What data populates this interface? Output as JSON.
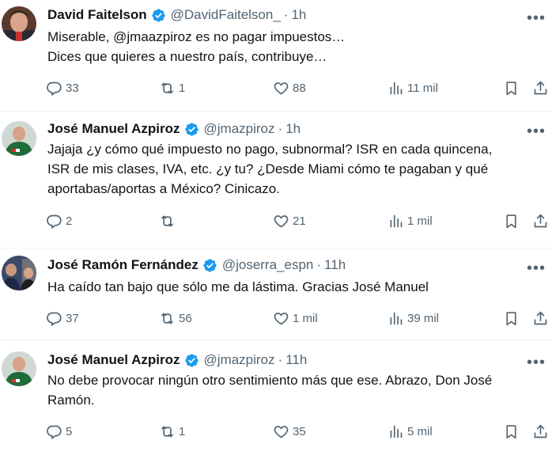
{
  "tweets": [
    {
      "name": "David Faitelson",
      "handle": "@DavidFaitelson_",
      "sep": "·",
      "time": "1h",
      "lines": [
        "Miserable, @jmaazpiroz es no pagar impuestos…",
        "Dices que quieres a nuestro país, contribuye…"
      ],
      "replies": "33",
      "retweets": "1",
      "likes": "88",
      "views": "11 mil"
    },
    {
      "name": "José Manuel Azpiroz",
      "handle": "@jmazpiroz",
      "sep": "·",
      "time": "1h",
      "lines": [
        "Jajaja ¿y cómo qué impuesto no pago, subnormal? ISR en cada quincena,",
        "ISR de mis clases, IVA, etc. ¿y tu? ¿Desde Miami cómo te pagaban y qué",
        "aportabas/aportas a México? Cinicazo."
      ],
      "replies": "2",
      "retweets": "",
      "likes": "21",
      "views": "1 mil"
    },
    {
      "name": "José Ramón Fernández",
      "handle": "@joserra_espn",
      "sep": "·",
      "time": "11h",
      "lines": [
        "Ha caído tan bajo que sólo me da lástima. Gracias José Manuel"
      ],
      "replies": "37",
      "retweets": "56",
      "likes": "1 mil",
      "views": "39 mil"
    },
    {
      "name": "José Manuel Azpiroz",
      "handle": "@jmazpiroz",
      "sep": "·",
      "time": "11h",
      "lines": [
        "No debe provocar ningún otro sentimiento  más que ese. Abrazo, Don José",
        "Ramón."
      ],
      "replies": "5",
      "retweets": "1",
      "likes": "35",
      "views": "5 mil"
    }
  ],
  "icons": {
    "reply": "reply-icon",
    "retweet": "retweet-icon",
    "like": "heart-icon",
    "views": "views-chart-icon",
    "bookmark": "bookmark-icon",
    "share": "share-icon",
    "verified": "verified-badge-icon",
    "more": "more-options-icon"
  },
  "colors": {
    "text": "#0f1419",
    "secondary": "#536471",
    "verified": "#1d9bf0",
    "divider": "#eff3f4"
  }
}
